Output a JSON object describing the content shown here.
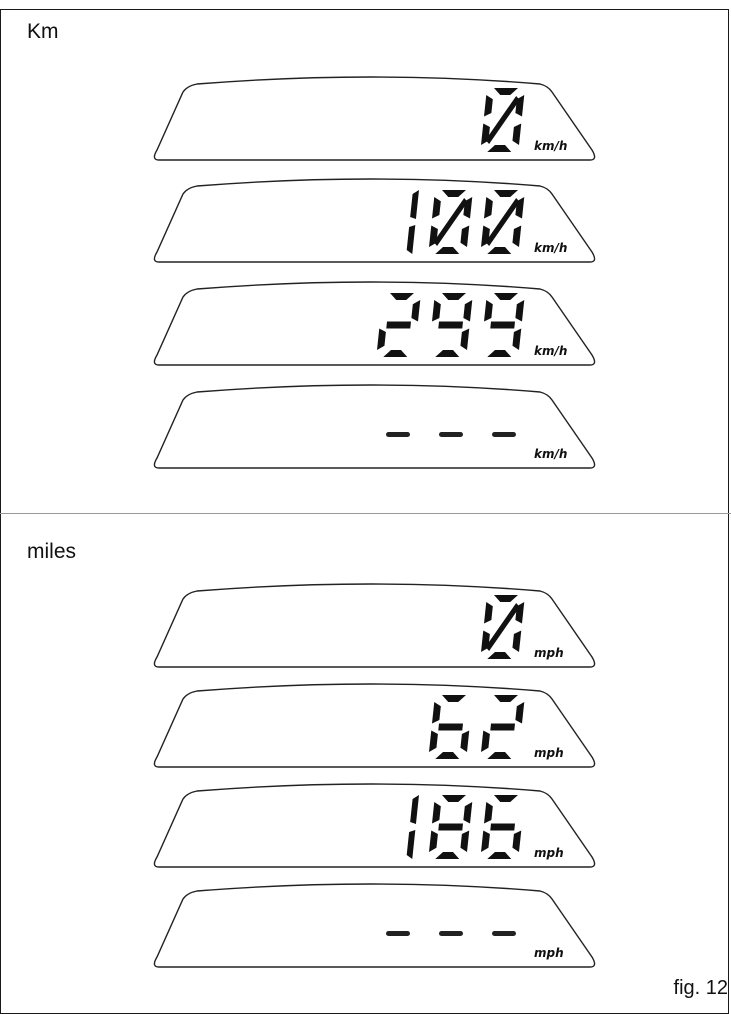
{
  "figure_label": "fig. 12",
  "sections": [
    {
      "label": "Km",
      "unit": "km/h",
      "displays": [
        {
          "value": "0"
        },
        {
          "value": "100"
        },
        {
          "value": "299"
        },
        {
          "value": "---"
        }
      ]
    },
    {
      "label": "miles",
      "unit": "mph",
      "displays": [
        {
          "value": "0"
        },
        {
          "value": "62"
        },
        {
          "value": "186"
        },
        {
          "value": "---"
        }
      ]
    }
  ]
}
